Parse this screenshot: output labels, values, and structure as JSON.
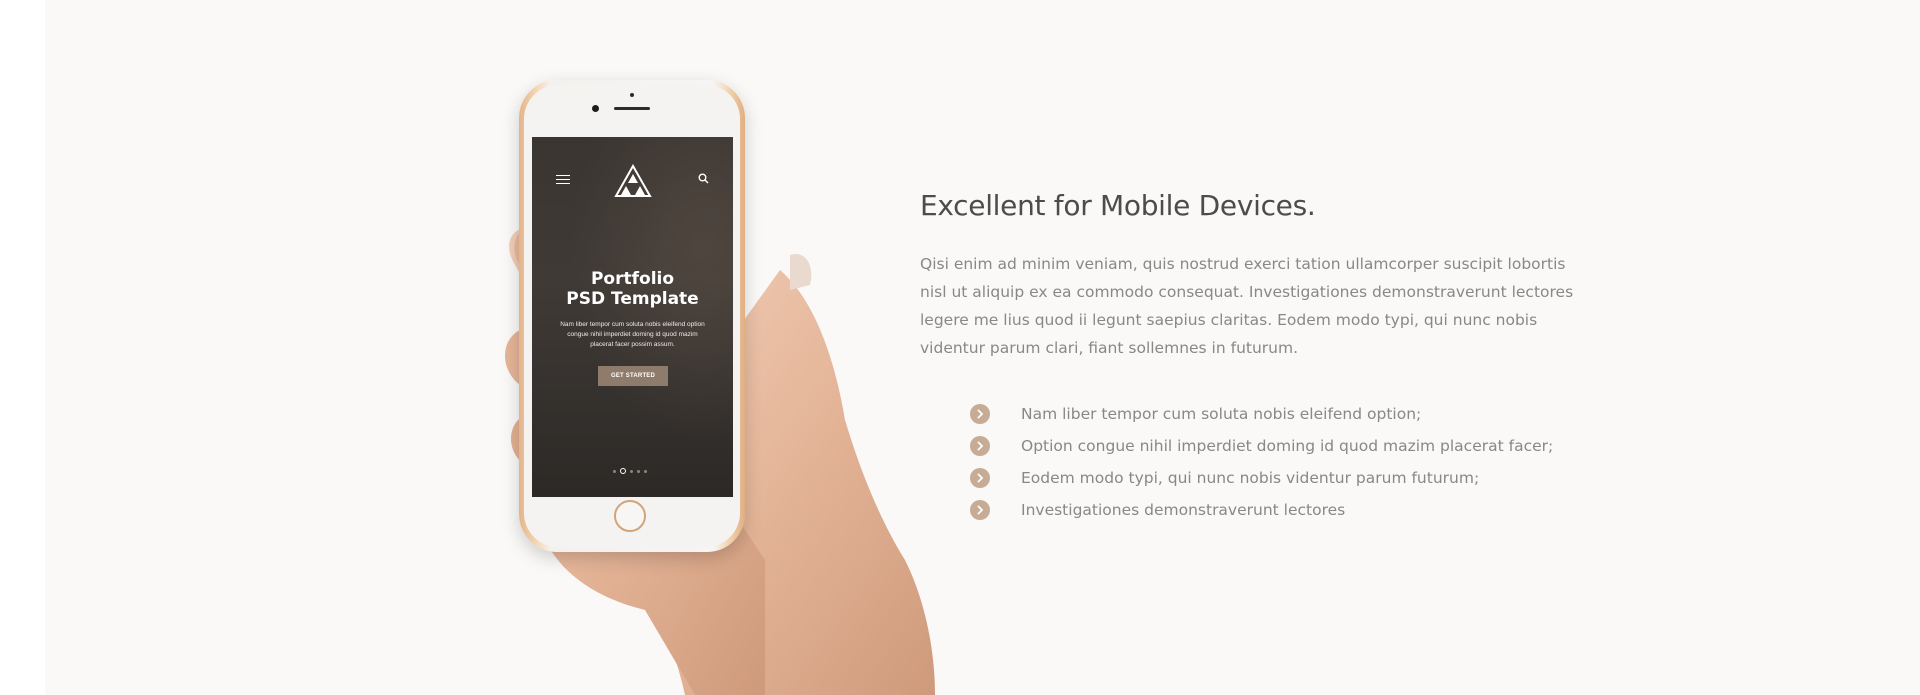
{
  "section": {
    "heading": "Excellent for Mobile Devices.",
    "paragraph": "Qisi enim ad minim veniam, quis nostrud exerci tation ullamcorper suscipit lobortis nisl ut aliquip ex ea commodo consequat. Investigationes demonstraverunt lectores legere me lius quod ii legunt saepius claritas. Eodem modo typi, qui nunc nobis videntur parum clari, fiant sollemnes in futurum.",
    "features": [
      {
        "text": "Nam liber tempor cum soluta nobis eleifend option;",
        "icon": "chevron-right-icon"
      },
      {
        "text": "Option congue nihil imperdiet doming id quod mazim placerat facer;",
        "icon": "chevron-right-icon"
      },
      {
        "text": "Eodem modo typi, qui nunc nobis videntur parum futurum;",
        "icon": "chevron-right-icon"
      },
      {
        "text": "Investigationes demonstraverunt lectores",
        "icon": "chevron-right-icon"
      }
    ]
  },
  "phone_screen": {
    "title": "Portfolio\nPSD Template",
    "text": "Nam liber tempor cum soluta nobis eleifend option congue nihil imperdiet doming id quod mazim placerat facer possim assum.",
    "cta_label": "GET STARTED",
    "menu_icon": "hamburger-icon",
    "search_icon": "search-icon",
    "logo_icon": "triangle-logo-icon",
    "slide_count": 5,
    "active_slide": 2
  },
  "colors": {
    "background": "#faf9f7",
    "heading": "#4e4c4a",
    "body_text": "#8a8785",
    "accent": "#c6ab95",
    "cta": "#8e7b6c"
  }
}
